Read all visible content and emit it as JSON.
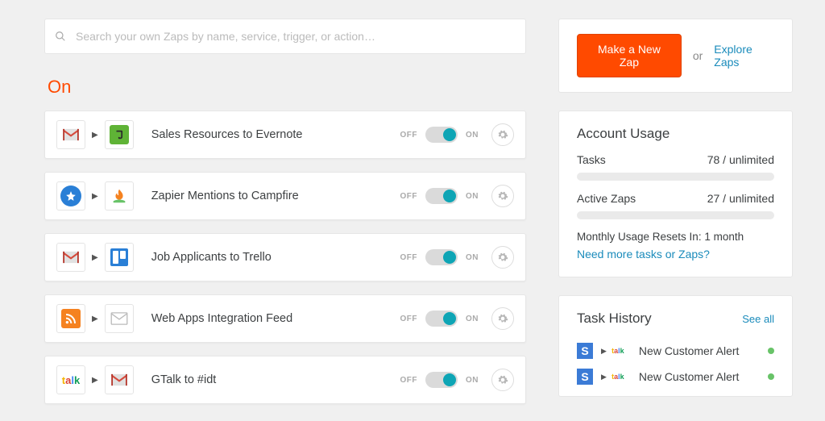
{
  "search": {
    "placeholder": "Search your own Zaps by name, service, trigger, or action…"
  },
  "section_on": "On",
  "toggle_off": "OFF",
  "toggle_on": "ON",
  "zaps": [
    {
      "name": "Sales Resources to Evernote"
    },
    {
      "name": "Zapier Mentions to Campfire"
    },
    {
      "name": "Job Applicants to Trello"
    },
    {
      "name": "Web Apps Integration Feed"
    },
    {
      "name": "GTalk to #idt"
    }
  ],
  "cta": {
    "make": "Make a New Zap",
    "or": "or",
    "explore": "Explore Zaps"
  },
  "usage": {
    "title": "Account Usage",
    "tasks_label": "Tasks",
    "tasks_value": "78 / unlimited",
    "zaps_label": "Active Zaps",
    "zaps_value": "27 / unlimited",
    "reset": "Monthly Usage Resets In: 1 month",
    "need_more": "Need more tasks or Zaps?"
  },
  "history": {
    "title": "Task History",
    "see_all": "See all",
    "items": [
      {
        "name": "New Customer Alert"
      },
      {
        "name": "New Customer Alert"
      }
    ]
  }
}
